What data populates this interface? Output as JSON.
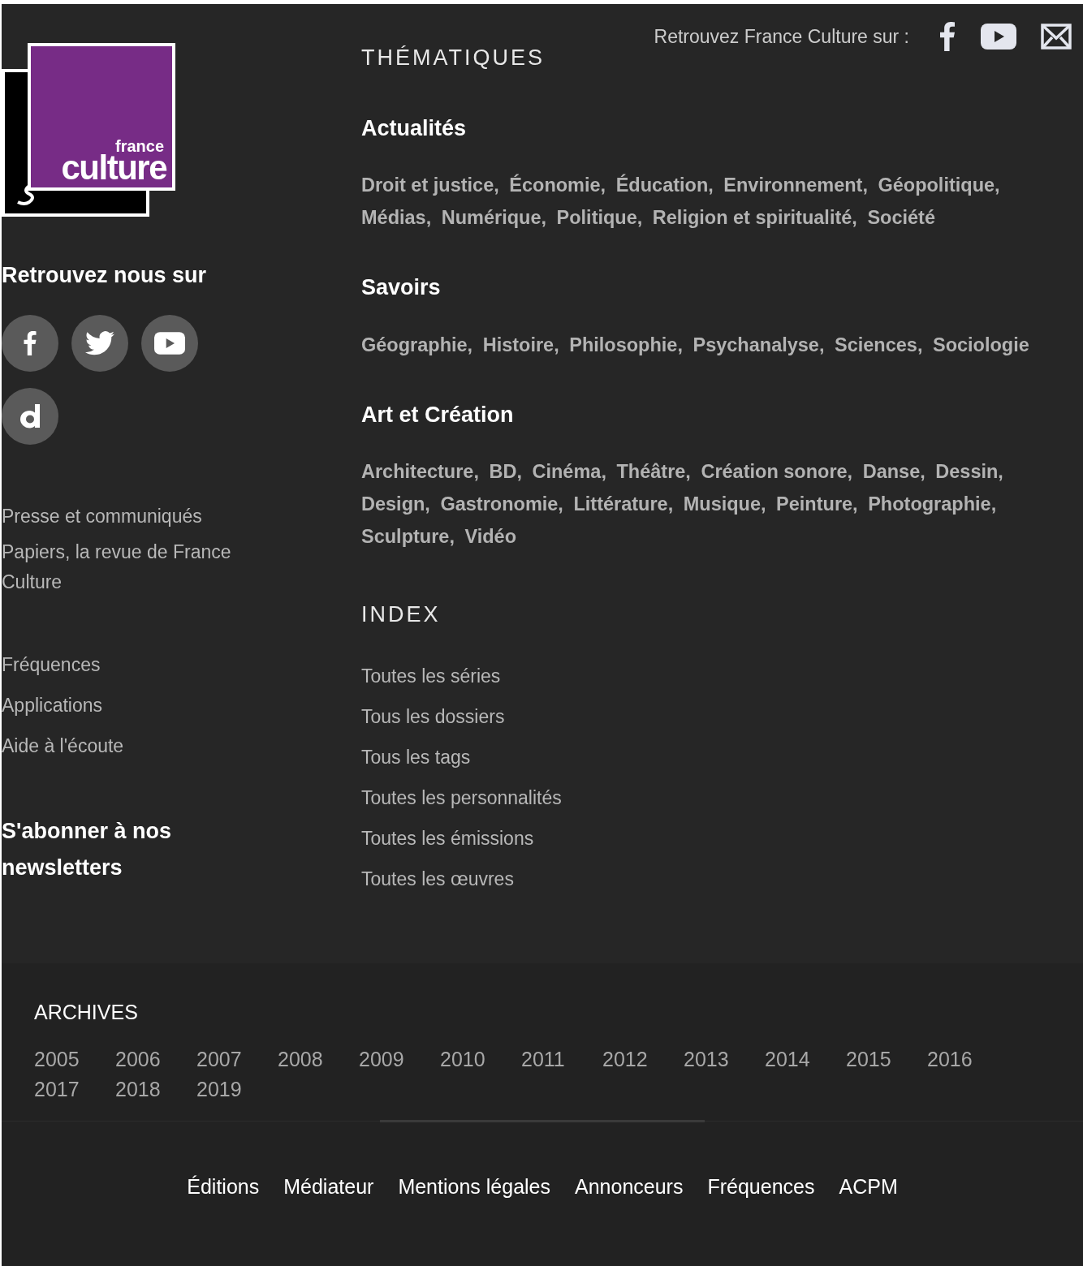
{
  "logo": {
    "line1": "france",
    "line2": "culture"
  },
  "follow_heading": "Retrouvez nous sur",
  "follow_icons": [
    {
      "kind": "facebook"
    },
    {
      "kind": "twitter"
    },
    {
      "kind": "youtube"
    },
    {
      "kind": "dailymotion"
    }
  ],
  "left_links_1": [
    "Presse et communiqués",
    "Papiers, la revue de France Culture"
  ],
  "left_links_2": [
    "Fréquences",
    "Applications",
    "Aide à l'écoute"
  ],
  "newsletter": "S'abonner à nos newsletters",
  "top_social": {
    "label": "Retrouvez France Culture sur :",
    "icons": [
      {
        "kind": "facebook"
      },
      {
        "kind": "youtube"
      },
      {
        "kind": "mail"
      }
    ]
  },
  "thematiques": {
    "title": "THÉMATIQUES",
    "groups": [
      {
        "title": "Actualités",
        "links": [
          "Droit et justice,",
          "Économie,",
          "Éducation,",
          "Environnement,",
          "Géopolitique,",
          "Médias,",
          "Numérique,",
          "Politique,",
          "Religion et spiritualité,",
          "Société"
        ]
      },
      {
        "title": "Savoirs",
        "links": [
          "Géographie,",
          "Histoire,",
          "Philosophie,",
          "Psychanalyse,",
          "Sciences,",
          "Sociologie"
        ]
      },
      {
        "title": "Art et Création",
        "links": [
          "Architecture,",
          "BD,",
          "Cinéma,",
          "Théâtre,",
          "Création sonore,",
          "Danse,",
          "Dessin,",
          "Design,",
          "Gastronomie,",
          "Littérature,",
          "Musique,",
          "Peinture,",
          "Photographie,",
          "Sculpture,",
          "Vidéo"
        ]
      }
    ]
  },
  "index": {
    "title": "INDEX",
    "links": [
      "Toutes les séries",
      "Tous les dossiers",
      "Tous les tags",
      "Toutes les personnalités",
      "Toutes les émissions",
      "Toutes les œuvres"
    ]
  },
  "archives": {
    "title": "ARCHIVES",
    "years": [
      "2005",
      "2006",
      "2007",
      "2008",
      "2009",
      "2010",
      "2011",
      "2012",
      "2013",
      "2014",
      "2015",
      "2016",
      "2017",
      "2018",
      "2019"
    ]
  },
  "bottom_links": [
    "Éditions",
    "Médiateur",
    "Mentions légales",
    "Annonceurs",
    "Fréquences",
    "ACPM"
  ]
}
